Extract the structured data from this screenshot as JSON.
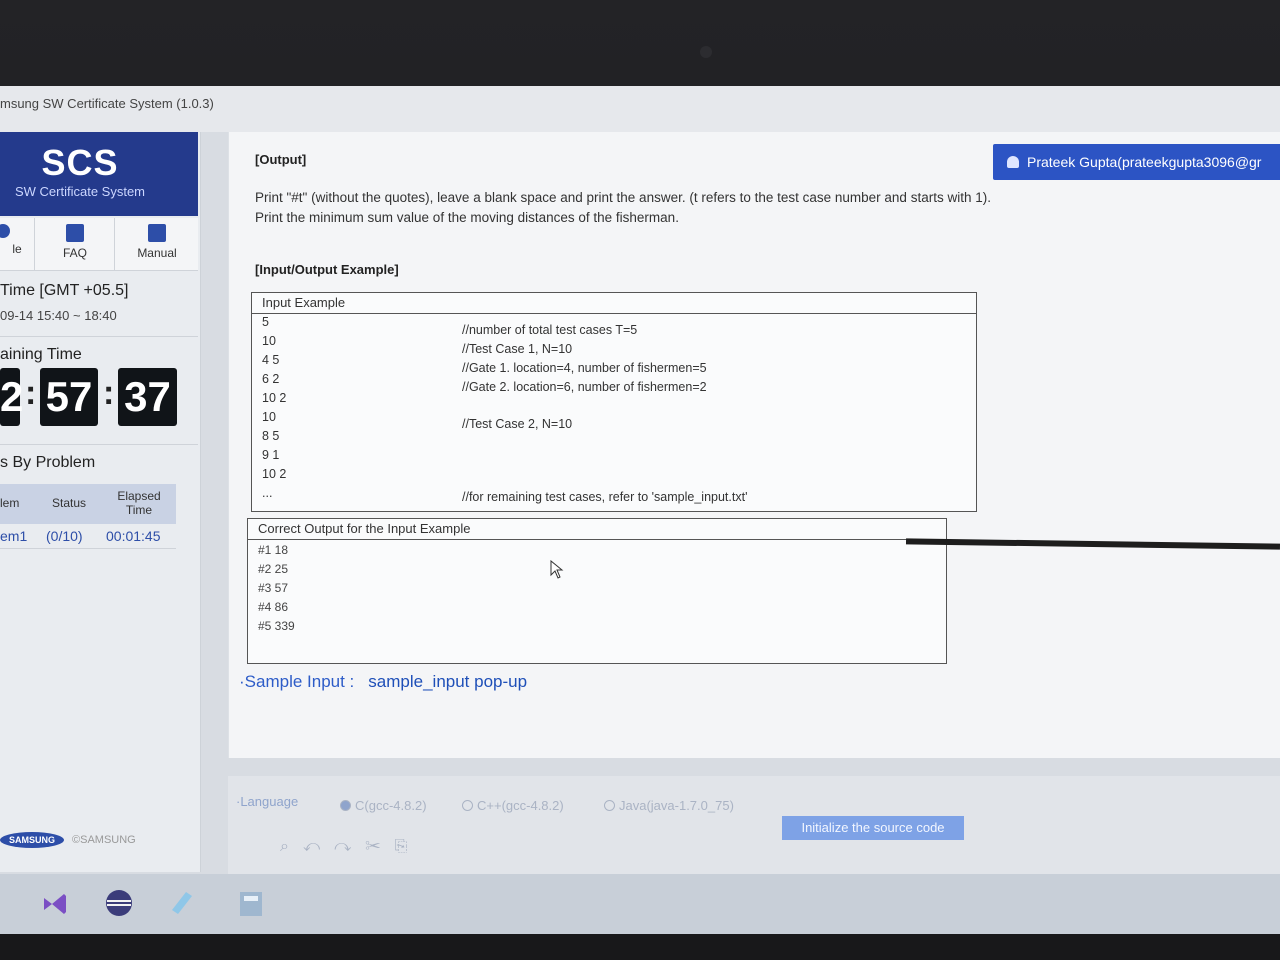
{
  "window": {
    "title": "msung SW Certificate System (1.0.3)"
  },
  "sidebar": {
    "logo_main": "SCS",
    "logo_sub": "SW Certificate System",
    "nav": {
      "left": "le",
      "faq": "FAQ",
      "manual": "Manual"
    },
    "time_label": "Time [GMT +05.5]",
    "time_range": "09-14 15:40 ~ 18:40",
    "remaining_label": "aining Time",
    "remaining": {
      "hours": "2",
      "minutes": "57",
      "seconds": "37"
    },
    "status_label": "s By Problem",
    "table": {
      "headers": [
        "lem",
        "Status",
        "Elapsed Time"
      ],
      "row": {
        "problem": "em1",
        "status": "(0/10)",
        "elapsed": "00:01:45"
      }
    },
    "samsung_logo": "SAMSUNG",
    "copyright": "©SAMSUNG"
  },
  "user": {
    "name": "Prateek Gupta(prateekgupta3096@gr"
  },
  "content": {
    "output_heading": "[Output]",
    "output_line1": "Print \"#t\" (without the quotes), leave a blank space and print the answer. (t refers to the test case number and starts with 1).",
    "output_line2": "Print the minimum sum value of the moving distances of the fisherman.",
    "example_heading": "[Input/Output Example]",
    "input_example": {
      "title": "Input Example",
      "lines": [
        "5",
        "10",
        "4 5",
        "6 2",
        "10 2",
        "10",
        "8 5",
        "9 1",
        "10 2",
        "..."
      ],
      "comments": [
        "//number of total test cases T=5",
        "//Test Case 1, N=10",
        "//Gate 1. location=4, number of fishermen=5",
        "//Gate 2. location=6, number of fishermen=2",
        "//Test Case 2, N=10",
        "//for remaining test cases, refer to 'sample_input.txt'"
      ]
    },
    "output_example": {
      "title": "Correct Output for the Input Example",
      "lines": [
        "#1 18",
        "#2 25",
        "#3 57",
        "#4 86",
        "#5 339"
      ]
    },
    "sample_label": "·Sample Input :",
    "sample_link": "sample_input pop-up"
  },
  "language": {
    "label": "·Language",
    "options": [
      "C(gcc-4.8.2)",
      "C++(gcc-4.8.2)",
      "Java(java-1.7.0_75)"
    ],
    "selected": "C(gcc-4.8.2)",
    "init_button": "Initialize the source code"
  },
  "icons": [
    "faq-icon",
    "manual-icon",
    "user-icon",
    "search-icon",
    "undo-icon",
    "redo-icon",
    "cut-icon",
    "copy-icon",
    "visual-studio-icon",
    "eclipse-icon",
    "notepad-icon",
    "calculator-icon"
  ],
  "colors": {
    "brand": "#243a8c",
    "accent": "#2c54c4",
    "link": "#2d5cc8"
  }
}
